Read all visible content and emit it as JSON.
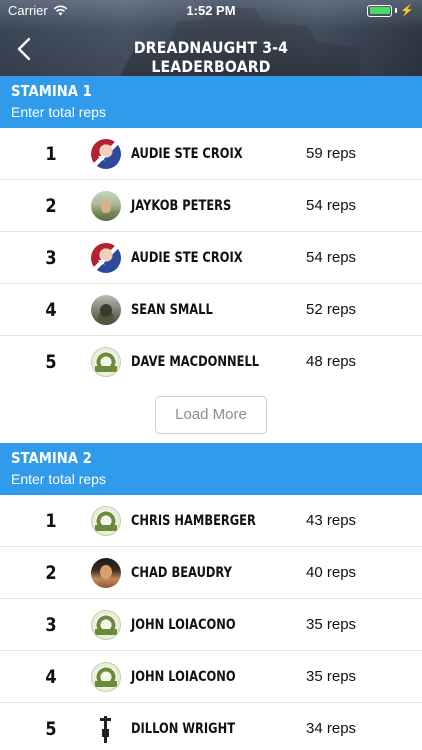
{
  "status_bar": {
    "carrier": "Carrier",
    "time": "1:52 PM",
    "battery_color": "#4cd964"
  },
  "nav": {
    "back_icon": "chevron-left-icon",
    "title": "DREADNAUGHT 3-4 LEADERBOARD"
  },
  "sections": [
    {
      "title": "STAMINA 1",
      "subtitle": "Enter total reps",
      "rows": [
        {
          "rank": "1",
          "name": "AUDIE STE CROIX",
          "score": "59 reps",
          "avatar": "flag-avatar"
        },
        {
          "rank": "2",
          "name": "JAYKOB PETERS",
          "score": "54 reps",
          "avatar": "outdoor-avatar"
        },
        {
          "rank": "3",
          "name": "AUDIE STE CROIX",
          "score": "54 reps",
          "avatar": "flag-avatar"
        },
        {
          "rank": "4",
          "name": "SEAN SMALL",
          "score": "52 reps",
          "avatar": "military-avatar"
        },
        {
          "rank": "5",
          "name": "DAVE MACDONNELL",
          "score": "48 reps",
          "avatar": "logo-avatar"
        }
      ],
      "load_more_label": "Load More"
    },
    {
      "title": "STAMINA 2",
      "subtitle": "Enter total reps",
      "rows": [
        {
          "rank": "1",
          "name": "CHRIS HAMBERGER",
          "score": "43 reps",
          "avatar": "logo-avatar"
        },
        {
          "rank": "2",
          "name": "CHAD BEAUDRY",
          "score": "40 reps",
          "avatar": "beach-avatar"
        },
        {
          "rank": "3",
          "name": "JOHN LOIACONO",
          "score": "35 reps",
          "avatar": "logo-avatar"
        },
        {
          "rank": "4",
          "name": "JOHN LOIACONO",
          "score": "35 reps",
          "avatar": "logo-avatar"
        },
        {
          "rank": "5",
          "name": "DILLON WRIGHT",
          "score": "34 reps",
          "avatar": "gun-avatar"
        }
      ]
    }
  ],
  "colors": {
    "section_header": "#2f9bea",
    "divider": "#e4e4e4"
  }
}
